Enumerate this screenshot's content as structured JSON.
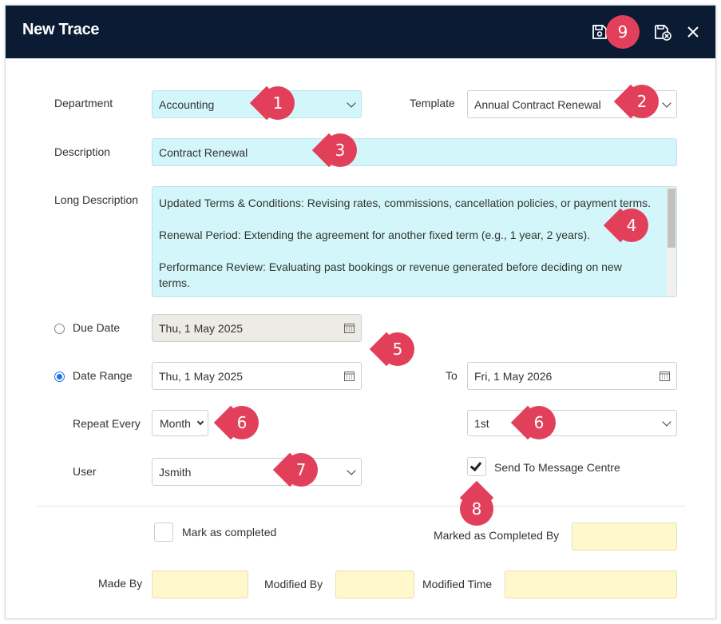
{
  "window": {
    "title": "New Trace",
    "header_bg": "#0b1b33",
    "icons": [
      "save-icon",
      "save-close-icon",
      "close-icon"
    ]
  },
  "form": {
    "department": {
      "label": "Department",
      "value": "Accounting"
    },
    "template": {
      "label": "Template",
      "value": "Annual Contract Renewal"
    },
    "description": {
      "label": "Description",
      "value": "Contract Renewal"
    },
    "long_description": {
      "label": "Long Description",
      "paragraphs": [
        "Updated Terms & Conditions: Revising rates, commissions, cancellation policies, or payment terms.",
        "Renewal Period: Extending the agreement for another fixed term (e.g., 1 year, 2 years).",
        "Performance Review: Evaluating past bookings or revenue generated before deciding on new terms."
      ]
    },
    "due_date": {
      "label": "Due Date",
      "value": "Thu, 1 May 2025",
      "selected": false
    },
    "date_range": {
      "label": "Date Range",
      "from": "Thu, 1 May 2025",
      "to_label": "To",
      "to": "Fri, 1 May 2026",
      "selected": true
    },
    "repeat_every": {
      "label": "Repeat Every",
      "value": "Month",
      "day_value": "1st"
    },
    "user": {
      "label": "User",
      "value": "Jsmith"
    },
    "send_to_message_centre": {
      "label": "Send To Message Centre",
      "checked": true
    },
    "mark_completed": {
      "label": "Mark as completed",
      "checked": false
    },
    "marked_completed_by": {
      "label": "Marked as Completed By",
      "value": ""
    },
    "made_by": {
      "label": "Made By",
      "value": ""
    },
    "modified_by": {
      "label": "Modified By",
      "value": ""
    },
    "modified_time": {
      "label": "Modified Time",
      "value": ""
    }
  },
  "markers": {
    "m1": "1",
    "m2": "2",
    "m3": "3",
    "m4": "4",
    "m5": "5",
    "m6a": "6",
    "m6b": "6",
    "m7": "7",
    "m8": "8",
    "m9": "9",
    "color": "#e2405a"
  },
  "colors": {
    "cyan_field": "#d3f6fa",
    "grey_field": "#ecebe6",
    "yellow_field": "#fff8cc",
    "radio_accent": "#1a73e8"
  }
}
